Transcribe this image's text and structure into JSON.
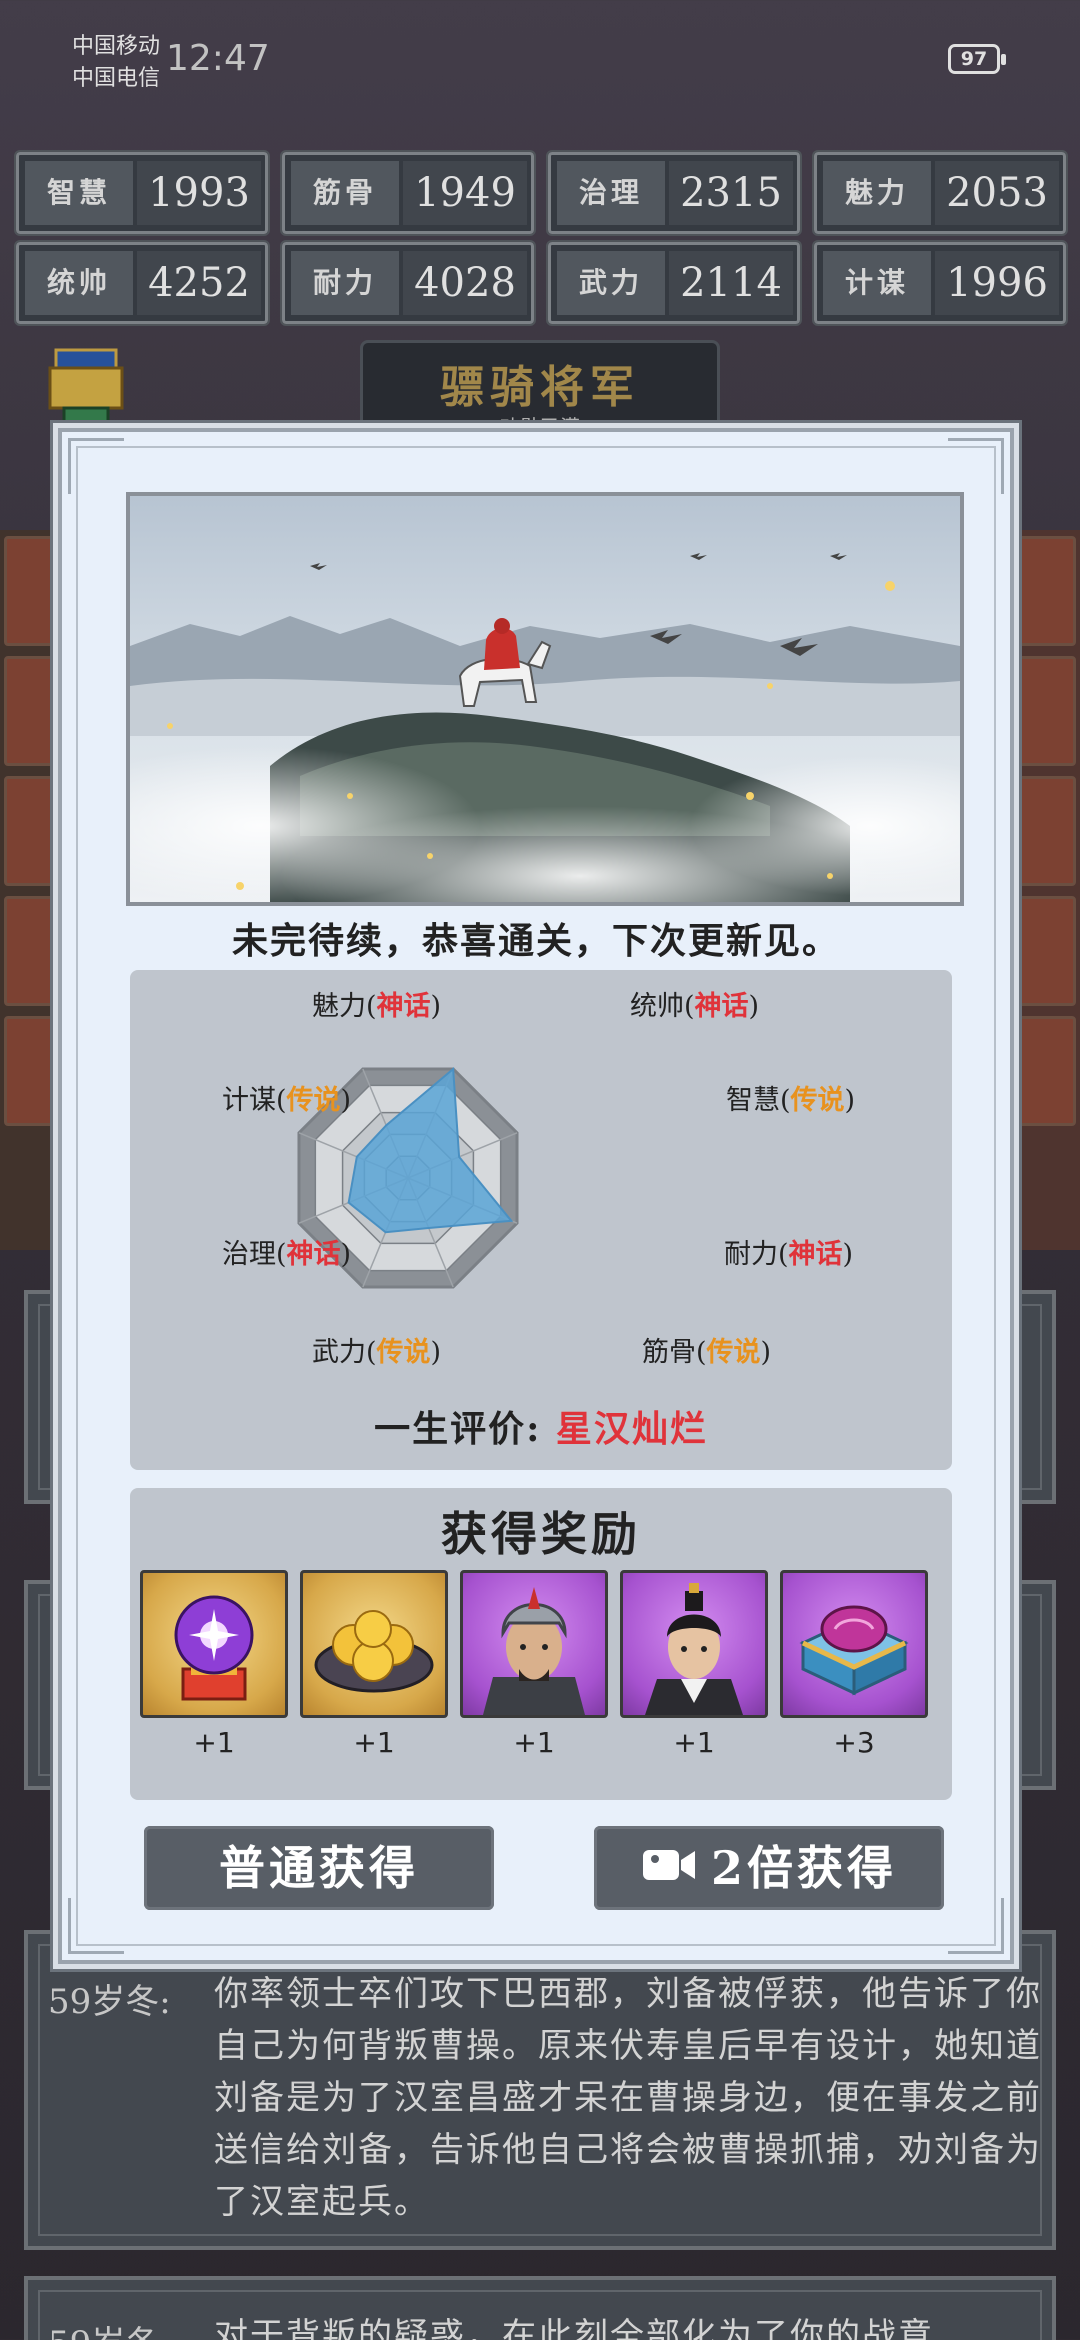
{
  "status_bar": {
    "carrier1": "中国移动",
    "carrier2": "中国电信",
    "time": "12:47",
    "battery": "97"
  },
  "stats": [
    {
      "label": "智慧",
      "value": "1993"
    },
    {
      "label": "筋骨",
      "value": "1949"
    },
    {
      "label": "治理",
      "value": "2315"
    },
    {
      "label": "魅力",
      "value": "2053"
    },
    {
      "label": "统帅",
      "value": "4252"
    },
    {
      "label": "耐力",
      "value": "4028"
    },
    {
      "label": "武力",
      "value": "2114"
    },
    {
      "label": "计谋",
      "value": "1996"
    }
  ],
  "rank": {
    "title": "骠骑将军",
    "subtitle": "功勋已满"
  },
  "background_log": [
    {
      "year": "59岁冬:",
      "text": "你率领士卒们攻下巴西郡，刘备被俘获，他告诉了你自己为何背叛曹操。原来伏寿皇后早有设计，她知道刘备是为了汉室昌盛才呆在曹操身边，便在事发之前送信给刘备，告诉他自己将会被曹操抓捕，劝刘备为了汉室起兵。"
    },
    {
      "year": "59岁冬:",
      "text": "对于背叛的疑惑，在此刻全部化为了你的战意"
    }
  ],
  "modal": {
    "ending_text": "未完待续，恭喜通关，下次更新见。",
    "radar": {
      "attributes": [
        {
          "name": "统帅",
          "grade": "神话",
          "grade_type": "myth",
          "value": 4252
        },
        {
          "name": "智慧",
          "grade": "传说",
          "grade_type": "legend",
          "value": 1993
        },
        {
          "name": "耐力",
          "grade": "神话",
          "grade_type": "myth",
          "value": 4028
        },
        {
          "name": "筋骨",
          "grade": "传说",
          "grade_type": "legend",
          "value": 1949
        },
        {
          "name": "武力",
          "grade": "传说",
          "grade_type": "legend",
          "value": 2114
        },
        {
          "name": "治理",
          "grade": "神话",
          "grade_type": "myth",
          "value": 2315
        },
        {
          "name": "计谋",
          "grade": "传说",
          "grade_type": "legend",
          "value": 1996
        },
        {
          "name": "魅力",
          "grade": "神话",
          "grade_type": "myth",
          "value": 2053
        }
      ],
      "eval_label": "一生评价: ",
      "eval_value": "星汉灿烂"
    },
    "rewards": {
      "title": "获得奖励",
      "items": [
        {
          "icon": "crystal-ball-icon",
          "count": "+1"
        },
        {
          "icon": "golden-buns-icon",
          "count": "+1"
        },
        {
          "icon": "armored-general-portrait",
          "count": "+1"
        },
        {
          "icon": "scholar-portrait",
          "count": "+1"
        },
        {
          "icon": "treasure-chest-icon",
          "count": "+3"
        }
      ]
    },
    "buttons": {
      "normal": "普通获得",
      "double": "2倍获得"
    }
  },
  "colors": {
    "myth": "#e0333a",
    "legend": "#e8921e",
    "radar_fill": "#5aa5d6"
  }
}
